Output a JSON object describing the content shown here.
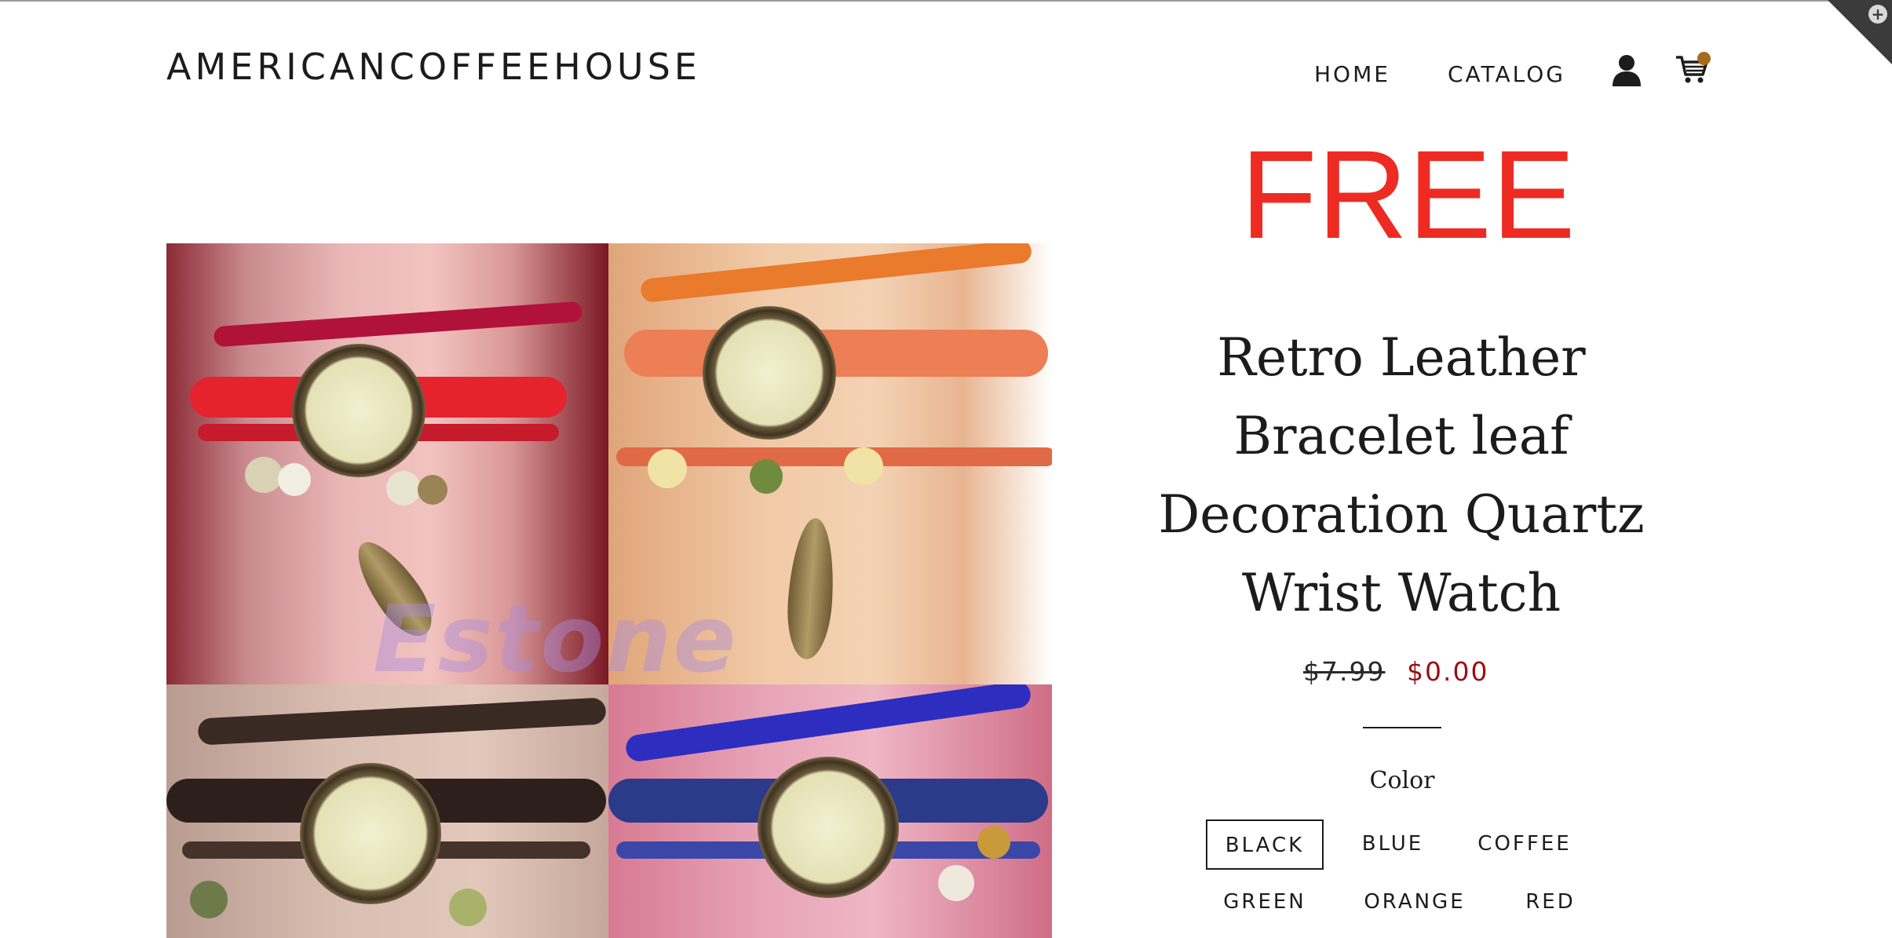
{
  "header": {
    "logo": "AMERICANCOFFEEHOUSE",
    "nav": [
      {
        "label": "HOME"
      },
      {
        "label": "CATALOG"
      }
    ],
    "icons": {
      "account": "user-icon",
      "cart": "cart-icon"
    }
  },
  "product": {
    "badge": "FREE",
    "title": "Retro Leather Bracelet leaf Decoration Quartz Wrist Watch",
    "price_original": "$7.99",
    "price_sale": "$0.00",
    "image_watermark": "Estone",
    "option_label": "Color",
    "options": [
      "BLACK",
      "BLUE",
      "COFFEE",
      "GREEN",
      "ORANGE",
      "RED"
    ],
    "selected_option": "BLACK"
  },
  "colors": {
    "badge": "#ee2b22",
    "sale_price": "#9b0d12",
    "cart_dot": "#a86a1d",
    "text": "#1c1c1c"
  }
}
